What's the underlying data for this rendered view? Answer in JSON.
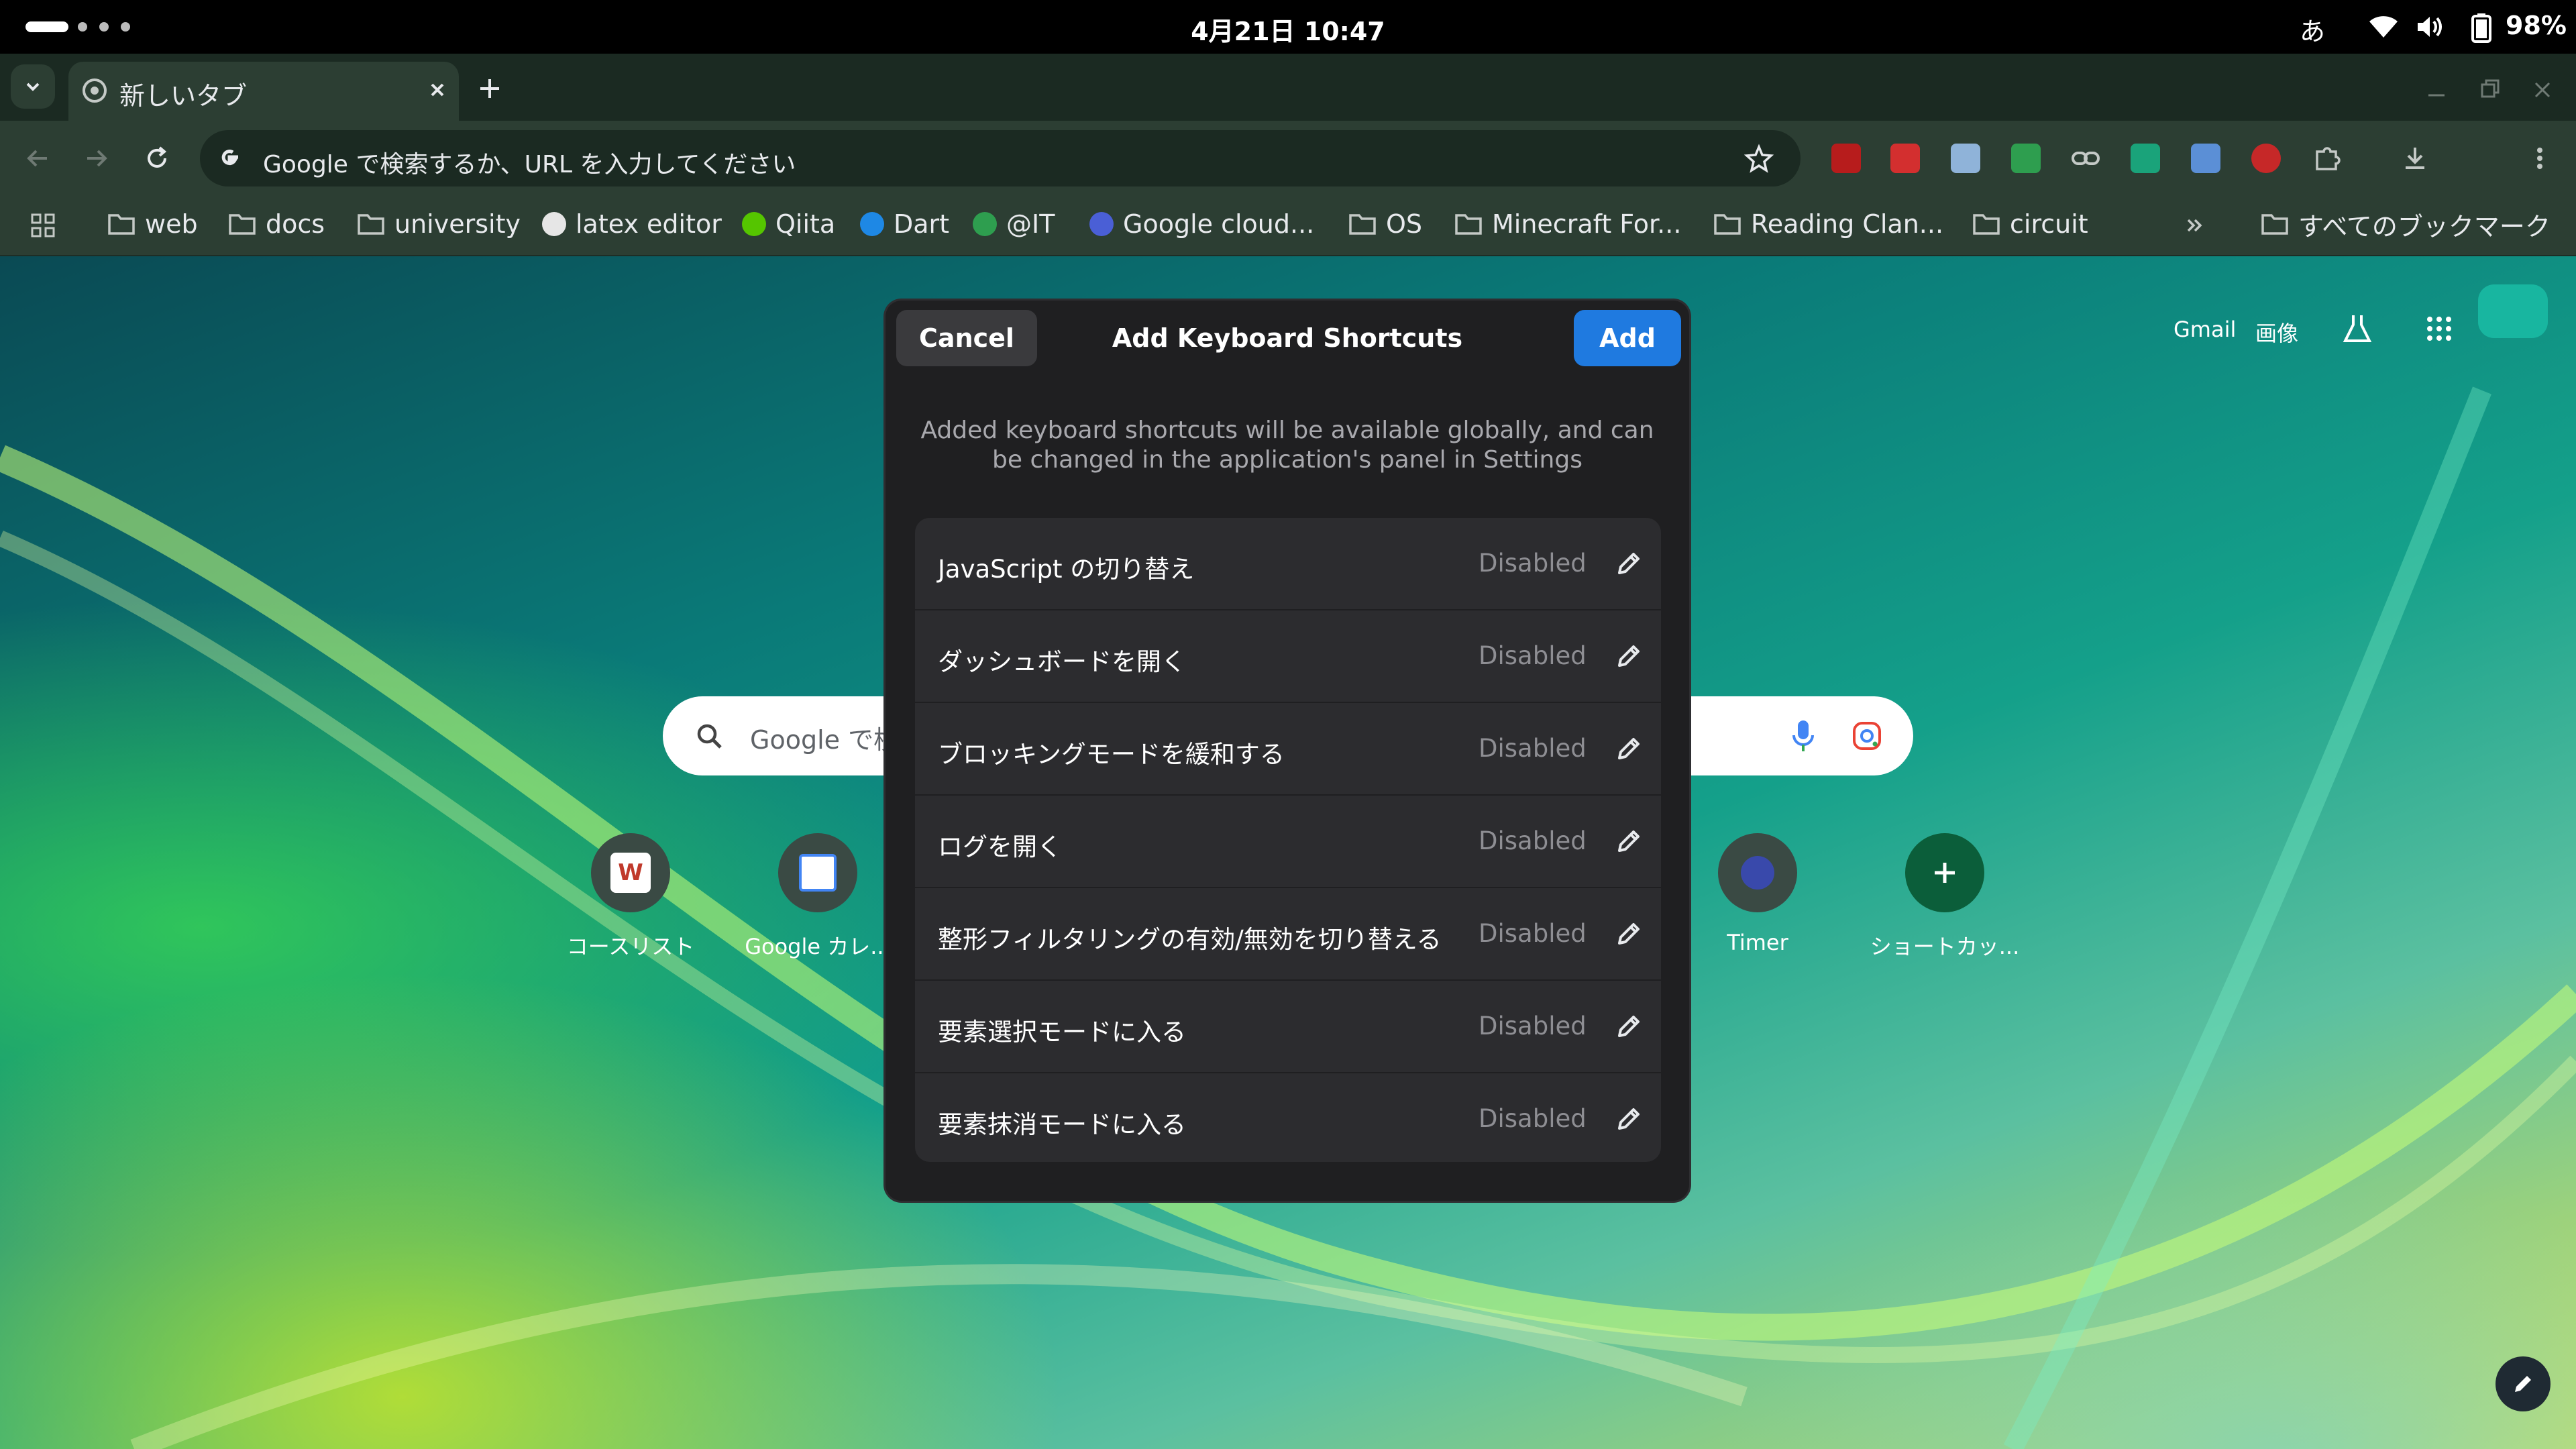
{
  "status_bar": {
    "clock": "4月21日 10:47",
    "ime": "あ",
    "battery": "98%"
  },
  "browser": {
    "tab": {
      "title": "新しいタブ"
    },
    "omnibox": {
      "text": "Google で検索するか、URL を入力してください"
    },
    "bookmarks": [
      {
        "label": "web",
        "icon": "folder-icon"
      },
      {
        "label": "docs",
        "icon": "folder-icon"
      },
      {
        "label": "university",
        "icon": "folder-icon"
      },
      {
        "label": "latex editor",
        "icon": "overleaf-icon"
      },
      {
        "label": "Qiita",
        "icon": "qiita-icon"
      },
      {
        "label": "Dart",
        "icon": "dart-icon"
      },
      {
        "label": "@IT",
        "icon": "atmark-icon"
      },
      {
        "label": "Google cloud...",
        "icon": "gcp-icon"
      },
      {
        "label": "OS",
        "icon": "folder-icon"
      },
      {
        "label": "Minecraft For...",
        "icon": "folder-icon"
      },
      {
        "label": "Reading Clan...",
        "icon": "folder-icon"
      },
      {
        "label": "circuit",
        "icon": "folder-icon"
      }
    ],
    "all_bookmarks": "すべてのブックマーク"
  },
  "ntp": {
    "gmail": "Gmail",
    "images": "画像",
    "search_placeholder": "Google で検",
    "tiles": [
      {
        "label": "コースリスト"
      },
      {
        "label": "Google カレ..."
      },
      {
        "label": "Timer"
      },
      {
        "label": "ショートカッ..."
      }
    ]
  },
  "dialog": {
    "cancel": "Cancel",
    "title": "Add Keyboard Shortcuts",
    "add": "Add",
    "description": "Added keyboard shortcuts will be available globally, and can be changed in the application's panel in Settings",
    "shortcuts": [
      {
        "name": "JavaScript の切り替え",
        "state": "Disabled"
      },
      {
        "name": "ダッシュボードを開く",
        "state": "Disabled"
      },
      {
        "name": "ブロッキングモードを緩和する",
        "state": "Disabled"
      },
      {
        "name": "ログを開く",
        "state": "Disabled"
      },
      {
        "name": "整形フィルタリングの有効/無効を切り替える",
        "state": "Disabled"
      },
      {
        "name": "要素選択モードに入る",
        "state": "Disabled"
      },
      {
        "name": "要素抹消モードに入る",
        "state": "Disabled"
      }
    ]
  },
  "colors": {
    "accent": "#1f7ae0",
    "dialog_bg": "#1f1f21",
    "row_bg": "#2c2c2f",
    "toolbar_bg": "#2c3e33"
  }
}
